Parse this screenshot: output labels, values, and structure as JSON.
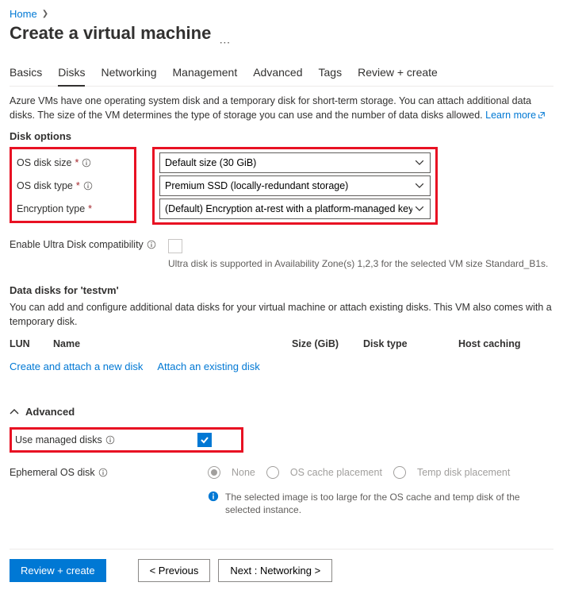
{
  "breadcrumb": {
    "home": "Home"
  },
  "title": "Create a virtual machine",
  "tabs": [
    "Basics",
    "Disks",
    "Networking",
    "Management",
    "Advanced",
    "Tags",
    "Review + create"
  ],
  "activeTab": "Disks",
  "intro": {
    "line": "Azure VMs have one operating system disk and a temporary disk for short-term storage. You can attach additional data disks. The size of the VM determines the type of storage you can use and the number of data disks allowed.",
    "learnMore": "Learn more"
  },
  "diskOptions": {
    "heading": "Disk options",
    "rows": {
      "osDiskSize": {
        "label": "OS disk size",
        "value": "Default size (30 GiB)"
      },
      "osDiskType": {
        "label": "OS disk type",
        "value": "Premium SSD (locally-redundant storage)"
      },
      "encryption": {
        "label": "Encryption type",
        "value": "(Default) Encryption at-rest with a platform-managed key"
      }
    },
    "ultra": {
      "label": "Enable Ultra Disk compatibility",
      "hint": "Ultra disk is supported in Availability Zone(s) 1,2,3 for the selected VM size Standard_B1s."
    }
  },
  "dataDisks": {
    "heading": "Data disks for 'testvm'",
    "desc": "You can add and configure additional data disks for your virtual machine or attach existing disks. This VM also comes with a temporary disk.",
    "cols": {
      "lun": "LUN",
      "name": "Name",
      "size": "Size (GiB)",
      "type": "Disk type",
      "cache": "Host caching"
    },
    "links": {
      "create": "Create and attach a new disk",
      "attach": "Attach an existing disk"
    }
  },
  "advanced": {
    "heading": "Advanced",
    "managed": {
      "label": "Use managed disks",
      "checked": true
    },
    "ephemeral": {
      "label": "Ephemeral OS disk",
      "options": [
        "None",
        "OS cache placement",
        "Temp disk placement"
      ],
      "selected": "None",
      "note": "The selected image is too large for the OS cache and temp disk of the selected instance."
    }
  },
  "footer": {
    "review": "Review + create",
    "prev": "< Previous",
    "next": "Next : Networking >"
  }
}
